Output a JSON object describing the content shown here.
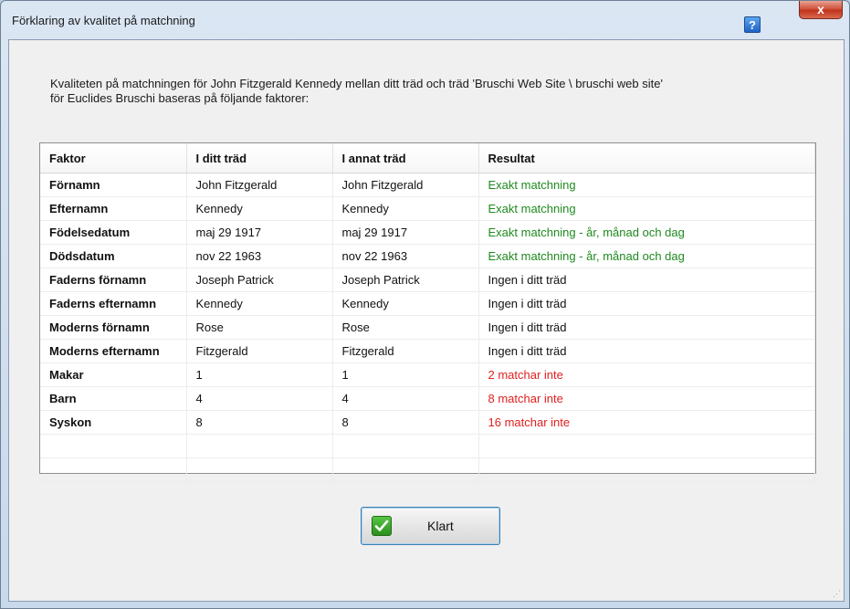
{
  "window": {
    "title": "Förklaring av kvalitet på matchning",
    "help_label": "?",
    "close_label": "x"
  },
  "intro": {
    "line1": "Kvaliteten på matchningen för John Fitzgerald Kennedy mellan ditt träd och träd 'Bruschi Web Site \\ bruschi web site'",
    "line2": "för Euclides Bruschi baseras på följande faktorer:"
  },
  "table": {
    "headers": [
      "Faktor",
      "I ditt träd",
      "I annat träd",
      "Resultat"
    ],
    "rows": [
      {
        "factor": "Förnamn",
        "mine": "John Fitzgerald",
        "other": "John Fitzgerald",
        "result": "Exakt matchning",
        "status": "ok"
      },
      {
        "factor": "Efternamn",
        "mine": "Kennedy",
        "other": "Kennedy",
        "result": "Exakt matchning",
        "status": "ok"
      },
      {
        "factor": "Födelsedatum",
        "mine": "maj 29 1917",
        "other": "maj 29 1917",
        "result": "Exakt matchning - år, månad och dag",
        "status": "ok"
      },
      {
        "factor": "Dödsdatum",
        "mine": "nov 22 1963",
        "other": "nov 22 1963",
        "result": "Exakt matchning - år, månad och dag",
        "status": "ok"
      },
      {
        "factor": "Faderns förnamn",
        "mine": "Joseph Patrick",
        "other": "Joseph Patrick",
        "result": "Ingen i ditt träd",
        "status": "neutral"
      },
      {
        "factor": "Faderns efternamn",
        "mine": "Kennedy",
        "other": "Kennedy",
        "result": "Ingen i ditt träd",
        "status": "neutral"
      },
      {
        "factor": "Moderns förnamn",
        "mine": "Rose",
        "other": "Rose",
        "result": "Ingen i ditt träd",
        "status": "neutral"
      },
      {
        "factor": "Moderns efternamn",
        "mine": "Fitzgerald",
        "other": "Fitzgerald",
        "result": "Ingen i ditt träd",
        "status": "neutral"
      },
      {
        "factor": "Makar",
        "mine": "1",
        "other": "1",
        "result": "2 matchar inte",
        "status": "bad"
      },
      {
        "factor": "Barn",
        "mine": "4",
        "other": "4",
        "result": "8 matchar inte",
        "status": "bad"
      },
      {
        "factor": "Syskon",
        "mine": "8",
        "other": "8",
        "result": "16 matchar inte",
        "status": "bad"
      }
    ],
    "empty_rows": 2
  },
  "buttons": {
    "done_label": "Klart",
    "done_icon": "checkmark-icon"
  },
  "colors": {
    "ok": "#1f8a1f",
    "bad": "#e02020",
    "neutral": "#111111"
  }
}
